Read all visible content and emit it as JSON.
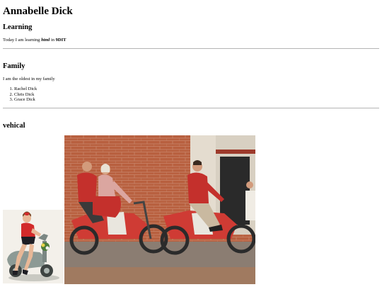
{
  "page": {
    "title": "Annabelle Dick",
    "learning": {
      "heading": "Learning",
      "text_before": "Today I am learning ",
      "emphasis": "html",
      "text_middle": " in ",
      "strong": "9DIT"
    },
    "family": {
      "heading": "Family",
      "text": "I am the oldest in my family",
      "members": [
        "Rachel Dick",
        "Chris Dick",
        "Grace Dick"
      ]
    },
    "vehical": {
      "heading": "vehical"
    }
  }
}
